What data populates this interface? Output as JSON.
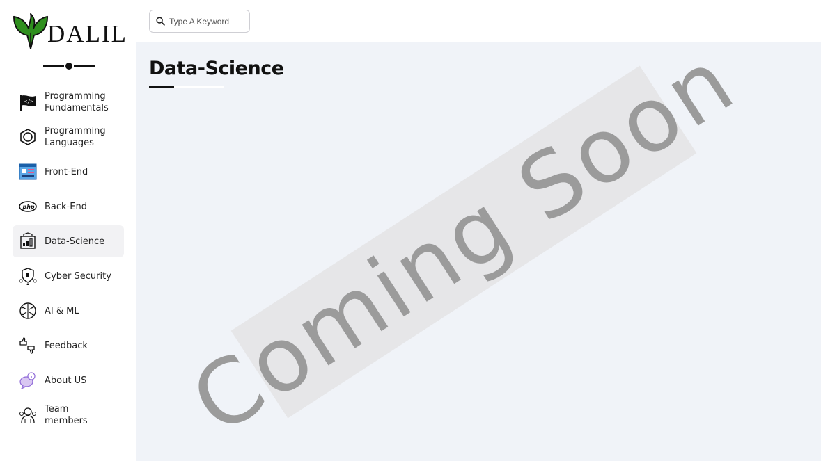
{
  "brand": {
    "name": "DALIL"
  },
  "search": {
    "placeholder": "Type A Keyword",
    "icon": "search-icon"
  },
  "sidebar": {
    "items": [
      {
        "label": "Programming Fundamentals",
        "icon": "code-flag-icon",
        "active": false
      },
      {
        "label": "Programming Languages",
        "icon": "c-sharp-icon",
        "active": false
      },
      {
        "label": "Front-End",
        "icon": "browser-window-icon",
        "active": false
      },
      {
        "label": "Back-End",
        "icon": "php-icon",
        "active": false
      },
      {
        "label": "Data-Science",
        "icon": "data-science-icon",
        "active": true
      },
      {
        "label": "Cyber Security",
        "icon": "shield-network-icon",
        "active": false
      },
      {
        "label": "AI & ML",
        "icon": "brain-circuit-icon",
        "active": false
      },
      {
        "label": "Feedback",
        "icon": "thumbs-icon",
        "active": false
      },
      {
        "label": "About US",
        "icon": "info-chat-icon",
        "active": false
      },
      {
        "label": "Team members",
        "icon": "team-icon",
        "active": false
      }
    ]
  },
  "main": {
    "title": "Data-Science",
    "banner": "Coming Soon"
  },
  "colors": {
    "brand_green": "#2f8f1e",
    "main_bg": "#f0f3f8",
    "banner_bg": "#e6e6e8",
    "banner_text": "#9b9b9b",
    "active_item_bg": "#f2f2f4"
  }
}
